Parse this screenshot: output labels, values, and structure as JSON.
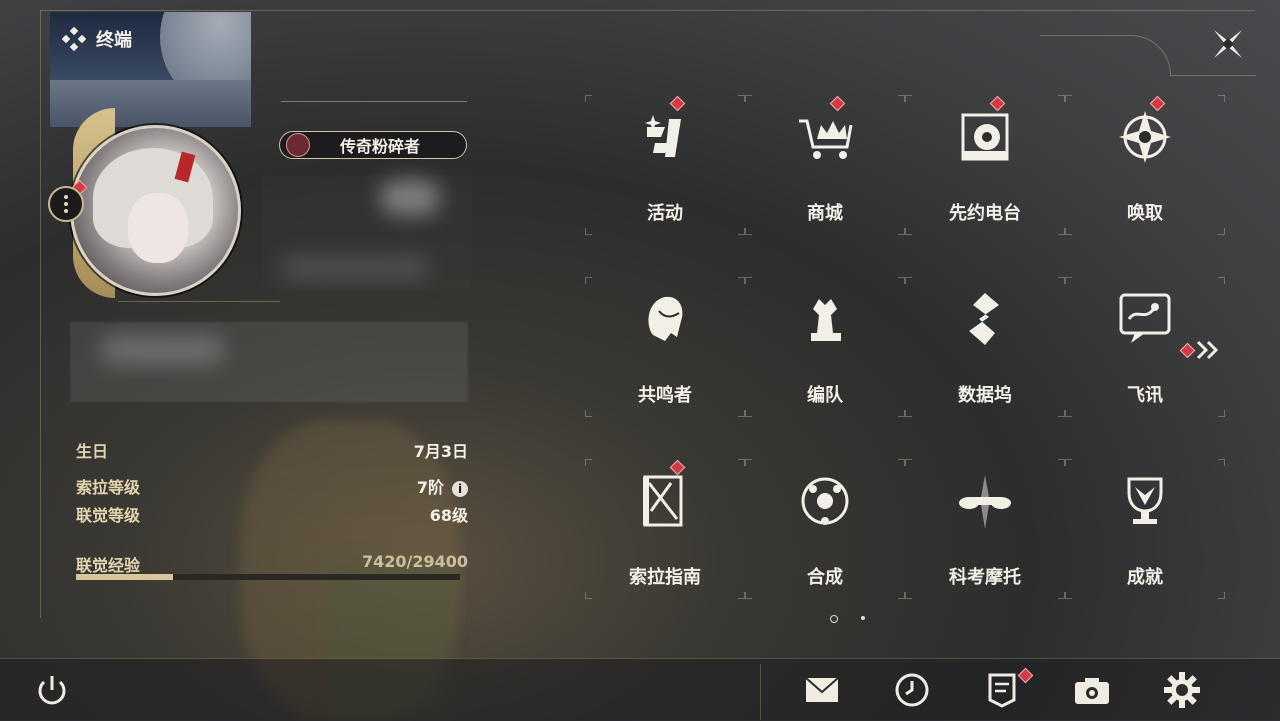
{
  "header": {
    "terminal_label": "终端"
  },
  "profile": {
    "title_badge": "传奇粉碎者",
    "info": [
      {
        "label": "生日",
        "value": "7月3日"
      },
      {
        "label": "索拉等级",
        "value": "7阶"
      },
      {
        "label": "联觉等级",
        "value": "68级"
      },
      {
        "label": "联觉经验",
        "value": "7420/29400"
      }
    ],
    "exp_progress": 0.252
  },
  "menu": {
    "items": [
      {
        "label": "活动",
        "icon": "activity-icon",
        "badge": true
      },
      {
        "label": "商城",
        "icon": "shop-cart-icon",
        "badge": true
      },
      {
        "label": "先约电台",
        "icon": "radio-icon",
        "badge": true
      },
      {
        "label": "唤取",
        "icon": "summon-compass-icon",
        "badge": true
      },
      {
        "label": "共鸣者",
        "icon": "resonator-head-icon",
        "badge": false
      },
      {
        "label": "编队",
        "icon": "team-chess-icon",
        "badge": false
      },
      {
        "label": "数据坞",
        "icon": "data-dock-icon",
        "badge": false
      },
      {
        "label": "飞讯",
        "icon": "message-chat-icon",
        "badge": false
      },
      {
        "label": "索拉指南",
        "icon": "guide-book-icon",
        "badge": true
      },
      {
        "label": "合成",
        "icon": "synthesis-icon",
        "badge": false
      },
      {
        "label": "科考摩托",
        "icon": "motorcycle-icon",
        "badge": false
      },
      {
        "label": "成就",
        "icon": "trophy-icon",
        "badge": false
      }
    ],
    "pages": 2,
    "current_page": 1
  },
  "bottom": {
    "icons": [
      "power-icon",
      "mail-icon",
      "clock-icon",
      "notice-icon",
      "camera-icon",
      "settings-gear-icon"
    ]
  },
  "colors": {
    "accent_gold": "#d8c59a",
    "badge_red": "#d43a44"
  }
}
